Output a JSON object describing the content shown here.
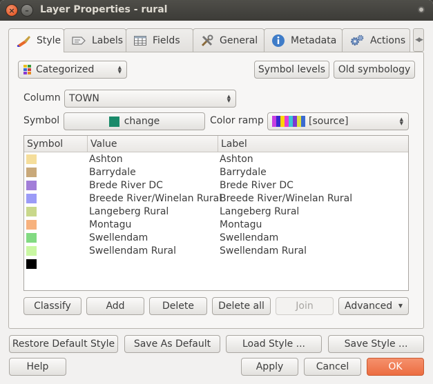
{
  "window": {
    "title": "Layer Properties - rural",
    "close_glyph": "×",
    "min_glyph": "–"
  },
  "tabs": [
    {
      "label": "Style",
      "icon": "paintbrush-icon"
    },
    {
      "label": "Labels",
      "icon": "labels-icon"
    },
    {
      "label": "Fields",
      "icon": "table-icon"
    },
    {
      "label": "General",
      "icon": "tools-icon"
    },
    {
      "label": "Metadata",
      "icon": "info-icon"
    },
    {
      "label": "Actions",
      "icon": "gears-icon"
    }
  ],
  "renderer": {
    "value": "Categorized",
    "icon": "categorized-icon"
  },
  "buttons": {
    "symbol_levels": "Symbol levels",
    "old_symbology": "Old symbology",
    "change": "change",
    "classify": "Classify",
    "add": "Add",
    "delete": "Delete",
    "delete_all": "Delete all",
    "join": "Join",
    "advanced": "Advanced",
    "restore_default": "Restore Default Style",
    "save_as_default": "Save As Default",
    "load_style": "Load Style ...",
    "save_style": "Save Style ...",
    "help": "Help",
    "apply": "Apply",
    "cancel": "Cancel",
    "ok": "OK"
  },
  "column": {
    "label": "Column",
    "value": "TOWN"
  },
  "symbol": {
    "label": "Symbol",
    "color": "#1a8a6a"
  },
  "color_ramp": {
    "label": "Color ramp",
    "value": "[source]",
    "colors": [
      "#c83fe0",
      "#3a2ad0",
      "#ffd400",
      "#e43ad4",
      "#3ac4d8",
      "#7a3ad0",
      "#e0e040",
      "#3a6ad0"
    ]
  },
  "table": {
    "headers": [
      "Symbol",
      "Value",
      "Label"
    ],
    "rows": [
      {
        "color": "#f5de9b",
        "value": "Ashton",
        "label": "Ashton"
      },
      {
        "color": "#c9a97a",
        "value": "Barrydale",
        "label": "Barrydale"
      },
      {
        "color": "#a27ed8",
        "value": "Brede River DC",
        "label": "Brede River DC"
      },
      {
        "color": "#9b9bf7",
        "value": "Breede River/Winelan Rural",
        "label": "Breede River/Winelan Rural"
      },
      {
        "color": "#c9d88b",
        "value": "Langeberg Rural",
        "label": "Langeberg Rural"
      },
      {
        "color": "#f7b27e",
        "value": "Montagu",
        "label": "Montagu"
      },
      {
        "color": "#82da82",
        "value": "Swellendam",
        "label": "Swellendam"
      },
      {
        "color": "#c9f7a2",
        "value": "Swellendam Rural",
        "label": "Swellendam Rural"
      },
      {
        "color": "#000000",
        "value": "",
        "label": ""
      }
    ]
  }
}
